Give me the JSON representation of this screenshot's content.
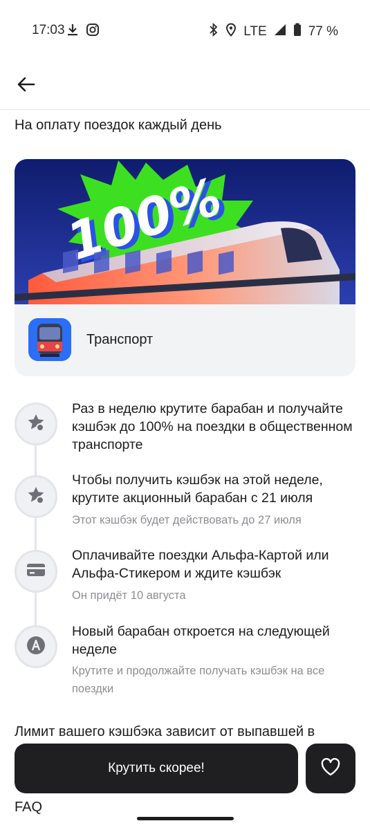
{
  "status_bar": {
    "time": "17:03",
    "network": "LTE",
    "battery": "77 %",
    "left_icons": [
      "download-icon",
      "instagram-icon"
    ],
    "right_icons": [
      "bluetooth-icon",
      "location-icon",
      "signal-icon",
      "battery-icon"
    ]
  },
  "header": {
    "subtitle": "На оплату поездок каждый день"
  },
  "card": {
    "banner_text": "100%",
    "label": "Транспорт"
  },
  "steps": [
    {
      "icon": "star-icon",
      "text": "Раз в неделю крутите барабан и получайте кэшбэк до 100% на поездки в общественном транспорте",
      "note": ""
    },
    {
      "icon": "star-icon",
      "text": "Чтобы получить кэшбэк на этой неделе, крутите акционный барабан с 21 июля",
      "note": "Этот кэшбэк будет действовать до 27 июля"
    },
    {
      "icon": "card-icon",
      "text": "Оплачивайте поездки Альфа-Картой или Альфа-Стикером и ждите кэшбэк",
      "note": "Он придёт 10 августа"
    },
    {
      "icon": "alfa-logo-icon",
      "text": "Новый барабан откроется на следующей неделе",
      "note": "Крутите и продолжайте получать кэшбэк на все поездки"
    }
  ],
  "limit_text": "Лимит вашего кэшбэка зависит от выпавшей в",
  "faq_text": "FAQ",
  "cta": {
    "label": "Крутить скорее!"
  },
  "colors": {
    "button_bg": "#1f1f22",
    "banner_sky": "#1a2a8c",
    "burst_green": "#3de021",
    "app_icon_blue": "#2b6ef7"
  }
}
